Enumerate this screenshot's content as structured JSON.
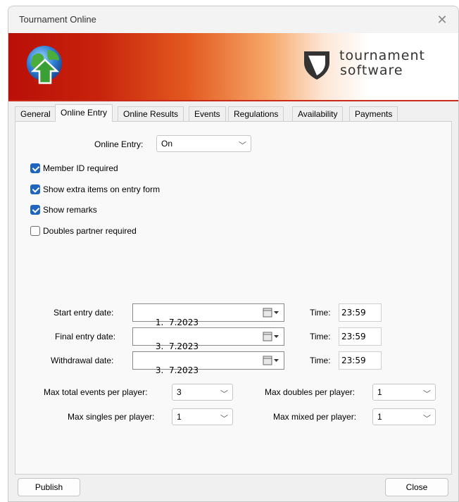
{
  "window": {
    "title": "Tournament Online",
    "close_glyph": "✕"
  },
  "banner": {
    "brand_line1": "tournament",
    "brand_line2": "software",
    "icon": "globe-upload-icon",
    "logo_icon": "shield-logo-icon",
    "colors": {
      "red": "#b90f08",
      "orange": "#e35a20",
      "green_arrow": "#3aa035"
    }
  },
  "tabs": [
    "General",
    "Online Entry",
    "Online Results",
    "Events",
    "Regulations",
    "Availability",
    "Payments"
  ],
  "active_tab": "Online Entry",
  "online_entry": {
    "label": "Online Entry:",
    "value": "On"
  },
  "checkboxes": [
    {
      "label": "Member ID required",
      "checked": true
    },
    {
      "label": "Show extra items on entry form",
      "checked": true
    },
    {
      "label": "Show remarks",
      "checked": true
    },
    {
      "label": "Doubles partner required",
      "checked": false
    }
  ],
  "dates": [
    {
      "label": "Start entry date:",
      "date": "1.  7.2023",
      "time_label": "Time:",
      "time": "23:59"
    },
    {
      "label": "Final entry date:",
      "date": "3.  7.2023",
      "time_label": "Time:",
      "time": "23:59"
    },
    {
      "label": "Withdrawal date:",
      "date": "3.  7.2023",
      "time_label": "Time:",
      "time": "23:59"
    }
  ],
  "limits": {
    "max_total_events_label": "Max total events per player:",
    "max_total_events": "3",
    "max_singles_label": "Max singles per player:",
    "max_singles": "1",
    "max_doubles_label": "Max doubles per player:",
    "max_doubles": "1",
    "max_mixed_label": "Max mixed per player:",
    "max_mixed": "1"
  },
  "buttons": {
    "publish": "Publish",
    "close": "Close"
  },
  "accent_color": "#1f65c0"
}
